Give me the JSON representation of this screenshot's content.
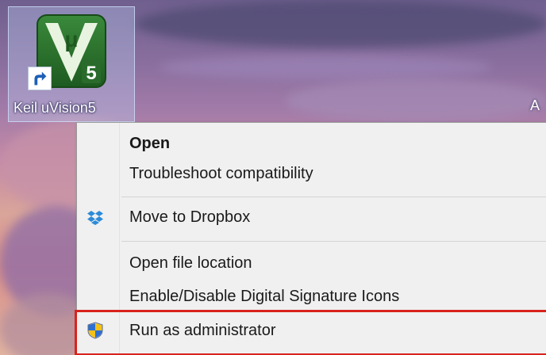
{
  "desktop": {
    "icon": {
      "label": "Keil uVision5",
      "glyph_mu": "μ",
      "glyph_version": "5",
      "brand_color": "#2a6b2c"
    },
    "partial_right_label": "A"
  },
  "context_menu": {
    "items": [
      {
        "label": "Open",
        "bold": true
      },
      {
        "label": "Troubleshoot compatibility"
      },
      {
        "label": "Move to Dropbox",
        "icon": "dropbox-icon"
      },
      {
        "label": "Open file location"
      },
      {
        "label": "Enable/Disable Digital Signature Icons"
      },
      {
        "label": "Run as administrator",
        "icon": "uac-shield-icon",
        "highlighted": true
      }
    ],
    "highlight_color": "#d9221c"
  }
}
